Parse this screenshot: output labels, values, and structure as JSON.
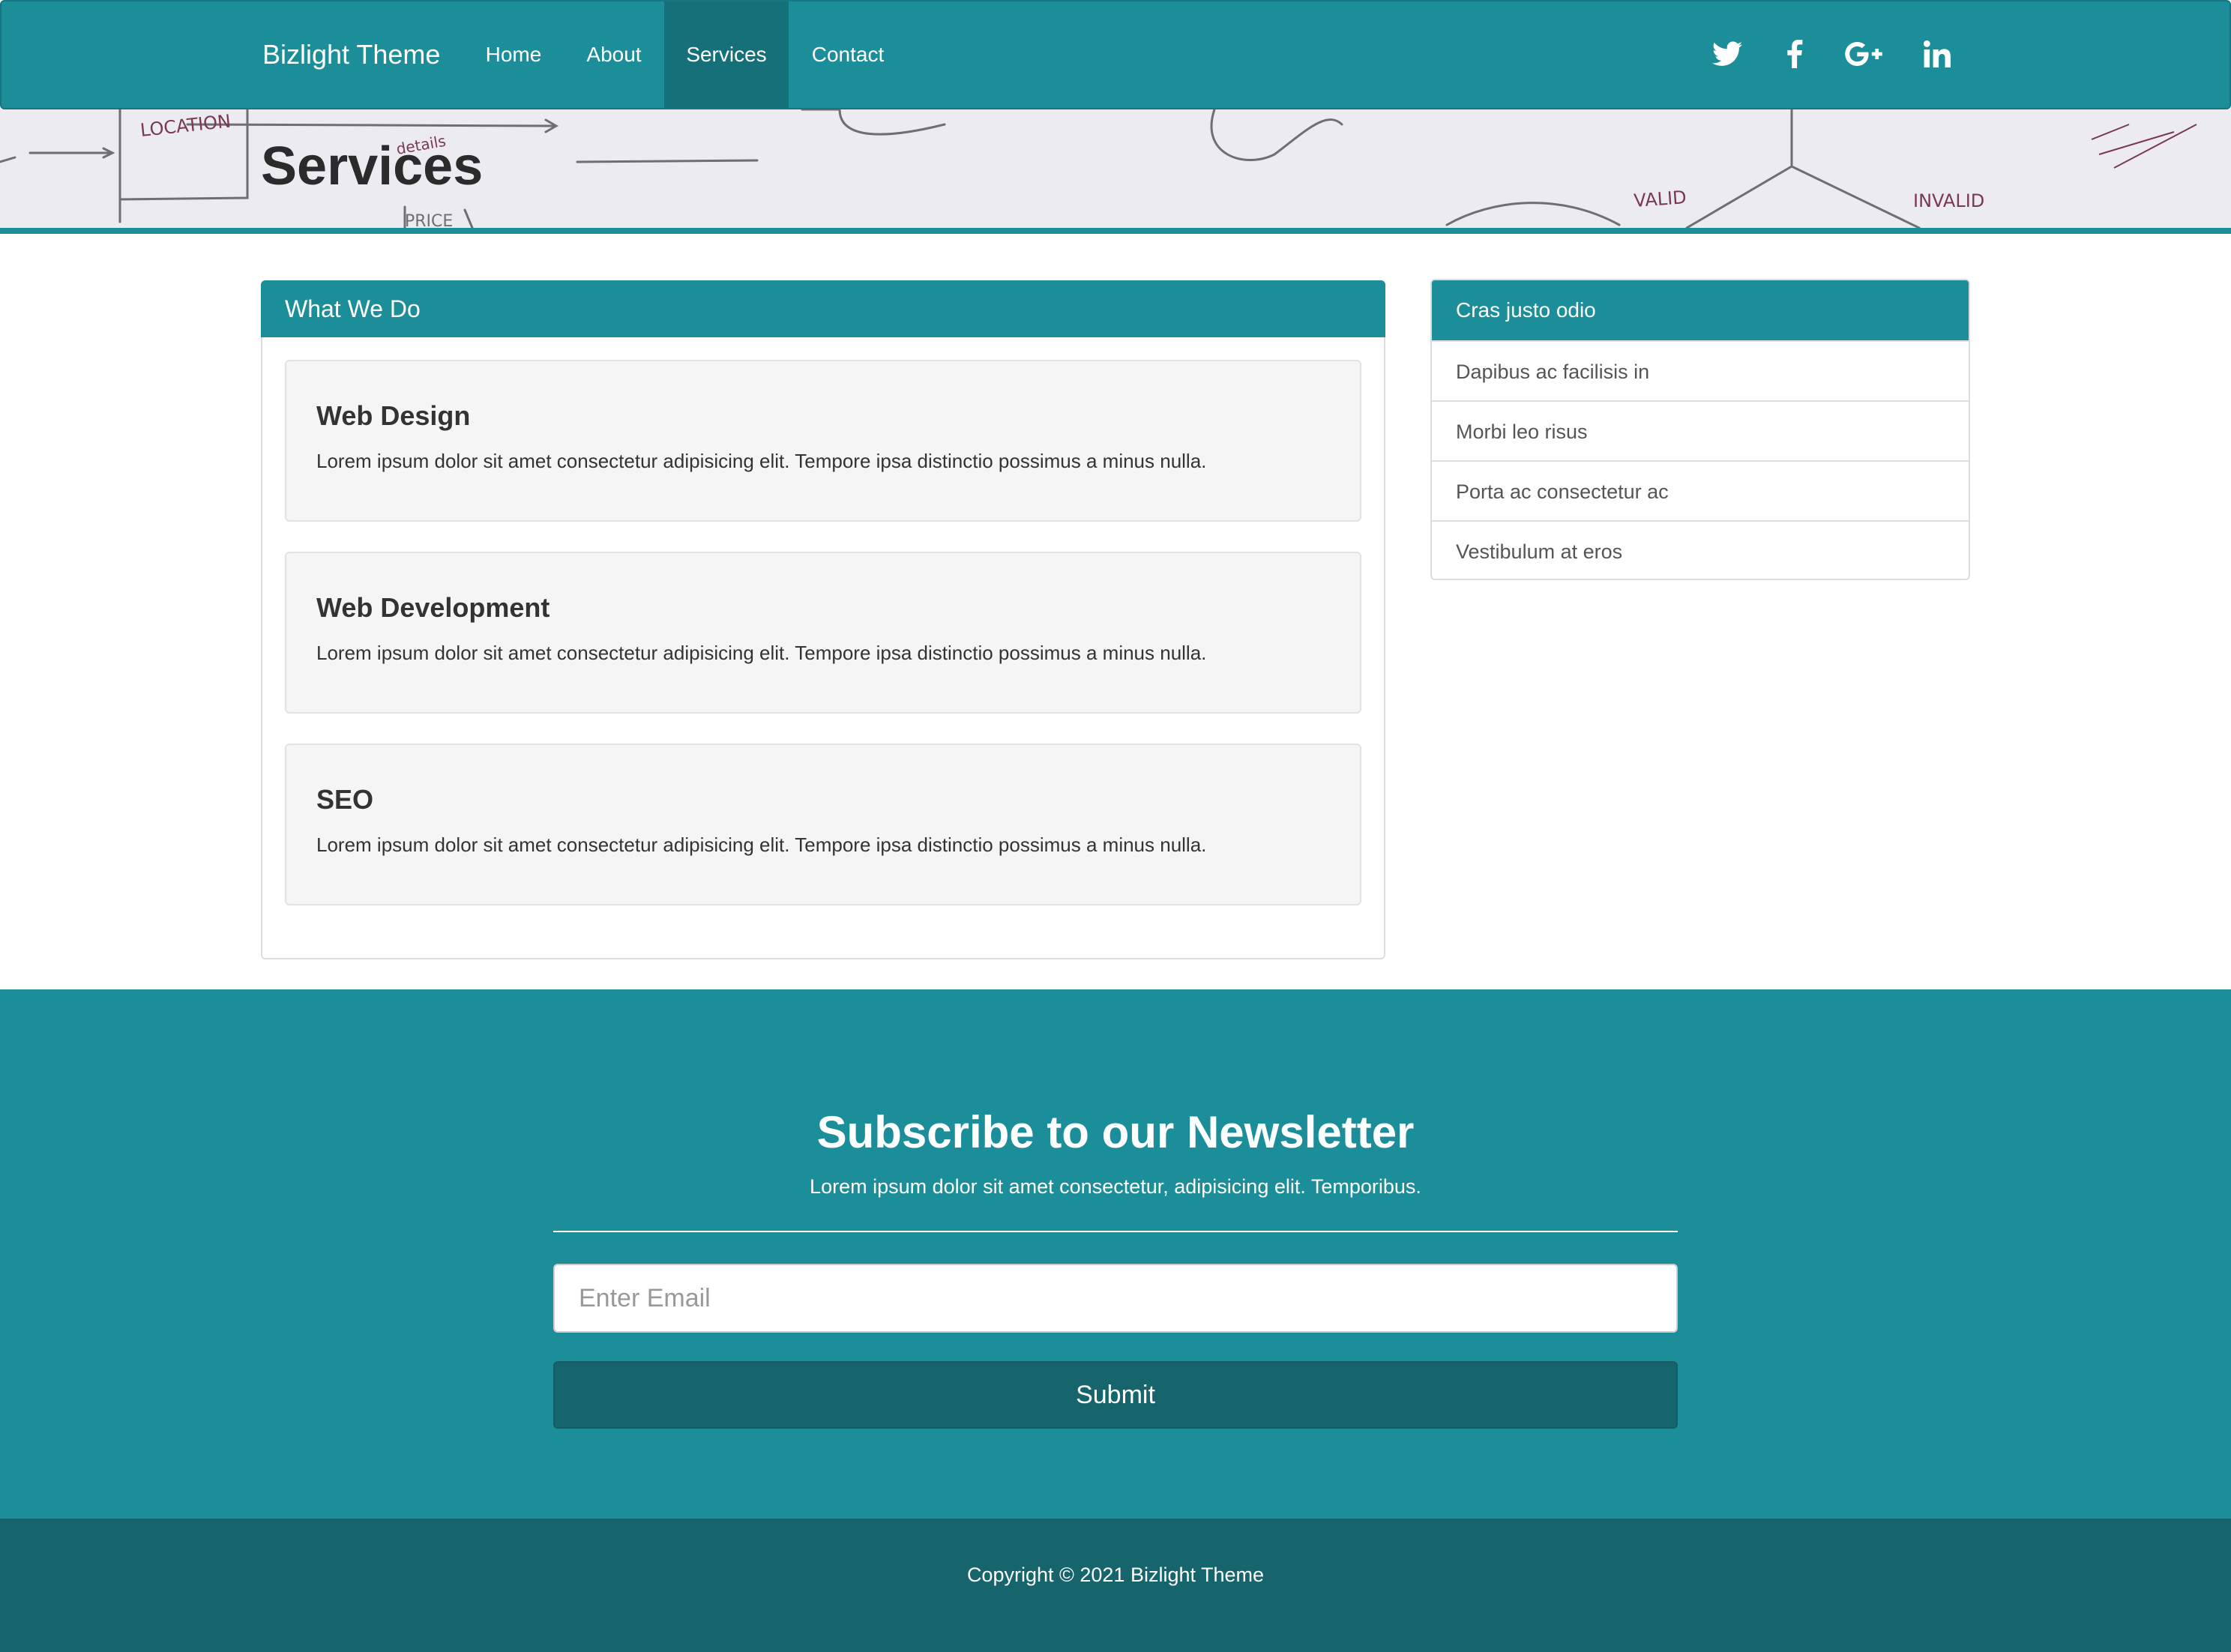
{
  "navbar": {
    "brand": "Bizlight Theme",
    "items": [
      {
        "label": "Home"
      },
      {
        "label": "About"
      },
      {
        "label": "Services",
        "active": true
      },
      {
        "label": "Contact"
      }
    ],
    "social": [
      "twitter-icon",
      "facebook-icon",
      "google-plus-icon",
      "linkedin-icon"
    ],
    "color": "#1c8e99"
  },
  "hero": {
    "title": "Services",
    "sketch_words": [
      "LOCATION",
      "details",
      "PRICE",
      "VALID",
      "INVALID"
    ]
  },
  "what_we_do": {
    "heading": "What We Do",
    "cards": [
      {
        "title": "Web Design",
        "text": "Lorem ipsum dolor sit amet consectetur adipisicing elit. Tempore ipsa distinctio possimus a minus nulla."
      },
      {
        "title": "Web Development",
        "text": "Lorem ipsum dolor sit amet consectetur adipisicing elit. Tempore ipsa distinctio possimus a minus nulla."
      },
      {
        "title": "SEO",
        "text": "Lorem ipsum dolor sit amet consectetur adipisicing elit. Tempore ipsa distinctio possimus a minus nulla."
      }
    ]
  },
  "sidebar": {
    "heading": "Cras justo odio",
    "items": [
      {
        "label": "Dapibus ac facilisis in"
      },
      {
        "label": "Morbi leo risus"
      },
      {
        "label": "Porta ac consectetur ac"
      },
      {
        "label": "Vestibulum at eros"
      }
    ]
  },
  "newsletter": {
    "title": "Subscribe to our Newsletter",
    "subtitle": "Lorem ipsum dolor sit amet consectetur, adipisicing elit. Temporibus.",
    "email_placeholder": "Enter Email",
    "email_value": "",
    "submit_label": "Submit"
  },
  "footer": {
    "copyright": "Copyright © 2021 Bizlight Theme"
  },
  "colors": {
    "primary": "#1c8e99",
    "dark": "#16656d",
    "hero_bg": "#ecebef"
  }
}
